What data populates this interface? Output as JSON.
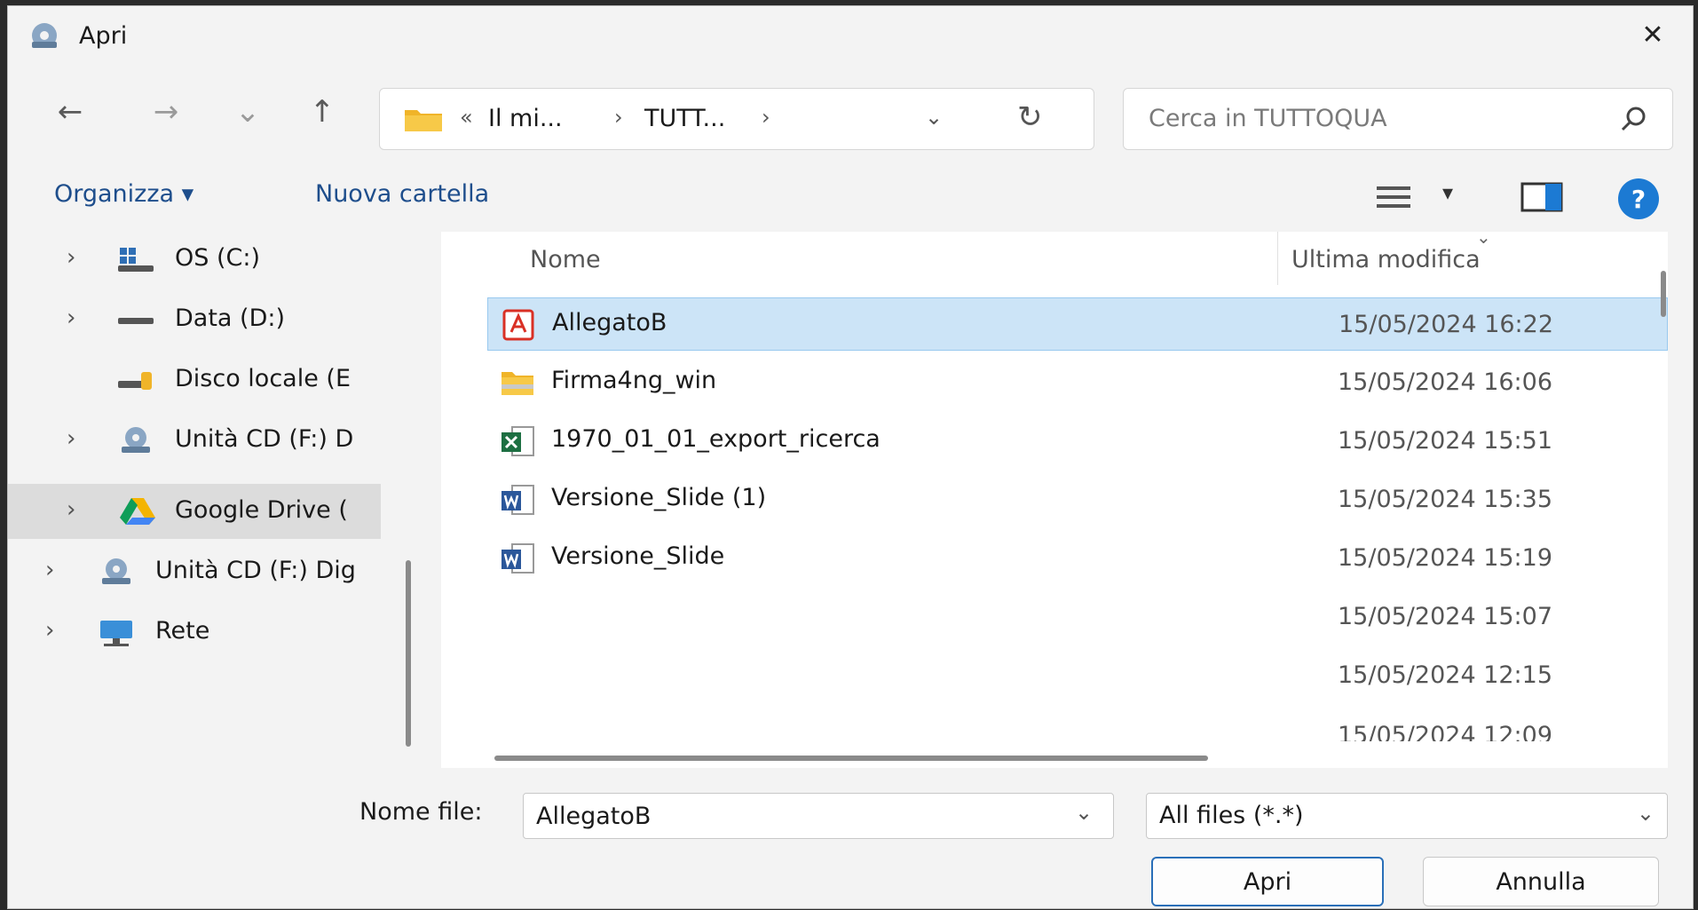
{
  "window": {
    "title": "Apri",
    "close_glyph": "✕"
  },
  "nav": {
    "back_glyph": "←",
    "forward_glyph": "→",
    "recent_glyph": "⌄",
    "up_glyph": "↑"
  },
  "address": {
    "overflow": "«",
    "crumbs": [
      "Il mi...",
      "TUTT..."
    ],
    "separator": "›",
    "dropdown_glyph": "⌄",
    "refresh_glyph": "↻"
  },
  "search": {
    "placeholder": "Cerca in TUTTOQUA"
  },
  "commands": {
    "organize": "Organizza ▾",
    "new_folder": "Nuova cartella",
    "view_drop": "▾",
    "help": "?"
  },
  "sidebar": {
    "items": [
      {
        "label": "OS (C:)",
        "icon": "drive-os-icon",
        "chevron": "›"
      },
      {
        "label": "Data (D:)",
        "icon": "drive-icon",
        "chevron": "›"
      },
      {
        "label": "Disco locale (E",
        "icon": "usb-drive-icon",
        "chevron": ""
      },
      {
        "label": "Unità CD (F:) D",
        "icon": "cd-drive-icon",
        "chevron": "›"
      },
      {
        "label": "Google Drive (",
        "icon": "google-drive-icon",
        "chevron": "›"
      },
      {
        "label": "Unità CD (F:) Dig",
        "icon": "cd-drive-icon",
        "chevron": "›"
      },
      {
        "label": "Rete",
        "icon": "network-icon",
        "chevron": "›"
      }
    ]
  },
  "files": {
    "columns": {
      "name": "Nome",
      "modified": "Ultima modifica"
    },
    "sort_indicator": "⌄",
    "rows": [
      {
        "name": "AllegatoB",
        "date": "15/05/2024 16:22",
        "icon": "pdf-icon"
      },
      {
        "name": "Firma4ng_win",
        "date": "15/05/2024 16:06",
        "icon": "zip-folder-icon"
      },
      {
        "name": "1970_01_01_export_ricerca",
        "date": "15/05/2024 15:51",
        "icon": "excel-icon"
      },
      {
        "name": "Versione_Slide (1)",
        "date": "15/05/2024 15:35",
        "icon": "word-icon"
      },
      {
        "name": "Versione_Slide",
        "date": "15/05/2024 15:19",
        "icon": "word-icon"
      },
      {
        "name": "",
        "date": "15/05/2024 15:07",
        "icon": ""
      },
      {
        "name": "",
        "date": "15/05/2024 12:15",
        "icon": ""
      },
      {
        "name": "",
        "date": "15/05/2024 12:09",
        "icon": ""
      }
    ]
  },
  "footer": {
    "filename_label": "Nome file:",
    "filename_value": "AllegatoB",
    "dropdown_glyph": "⌄",
    "filter_value": "All files (*.*)",
    "open_label": "Apri",
    "cancel_label": "Annulla"
  },
  "colors": {
    "accent": "#1c7ad3",
    "selection": "#cce4f7",
    "link": "#1e4e8c"
  }
}
